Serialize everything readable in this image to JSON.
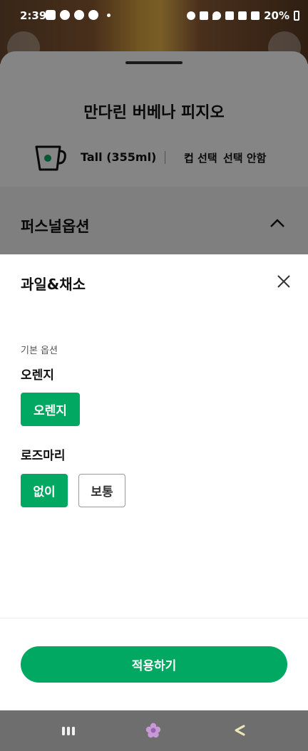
{
  "status_bar": {
    "time": "2:39",
    "battery": "20%"
  },
  "product": {
    "title": "만다린 버베나 피지오",
    "size": "Tall (355ml)",
    "cup_label": "컵 선택",
    "cup_value": "선택 안함",
    "section_title": "퍼스널옵션"
  },
  "sheet": {
    "title": "과일&채소",
    "group_label": "기본 옵션",
    "options": [
      {
        "name": "오렌지",
        "choices": [
          "오렌지"
        ],
        "selected": "오렌지"
      },
      {
        "name": "로즈마리",
        "choices": [
          "없이",
          "보통"
        ],
        "selected": "없이"
      }
    ],
    "apply_label": "적용하기"
  },
  "colors": {
    "accent": "#00a862",
    "navbar": "#6e6e6e"
  },
  "icons": [
    "close-icon",
    "cup-icon",
    "chevron-up-icon",
    "recent-apps-icon",
    "home-icon",
    "back-icon"
  ]
}
